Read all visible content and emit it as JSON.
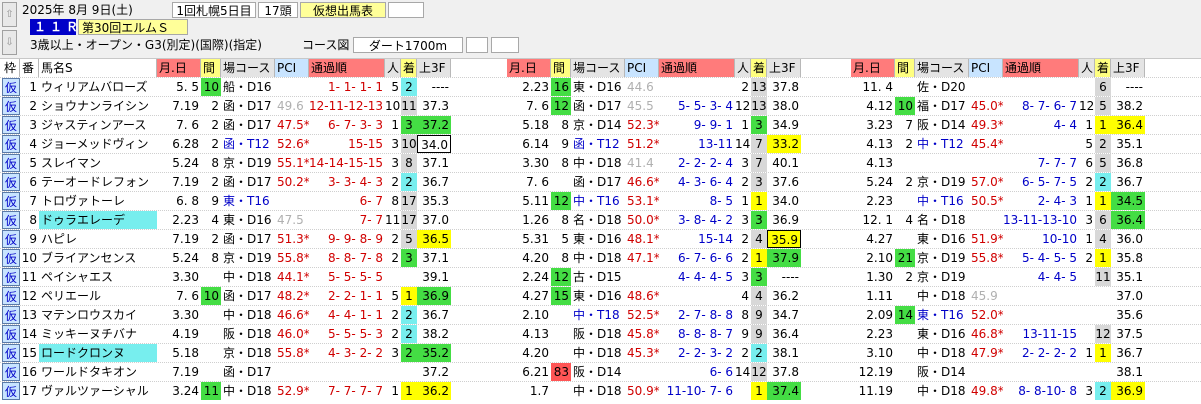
{
  "header": {
    "date": "2025年 8月 9日(土)",
    "kai": "1回札幌5日目",
    "heads": "17頭",
    "status": "仮想出馬表",
    "race_number": "１１Ｒ",
    "race_name": "第30回エルムＳ",
    "conditions": "3歳以上・オープン・G3(別定)(国際)(指定)",
    "course_label": "コース図",
    "course": "ダート1700m"
  },
  "columns": [
    "枠",
    "番",
    "馬名S",
    "月.日",
    "間",
    "場コース",
    "PCI",
    "通過順",
    "人",
    "着",
    "上3F",
    "月.日",
    "間",
    "場コース",
    "PCI",
    "通過順",
    "人",
    "着",
    "上3F",
    "月.日",
    "間",
    "場コース",
    "PCI",
    "通過順",
    "人",
    "着",
    "上3F"
  ],
  "colors": {
    "waku_bg": "#c8e4ff",
    "highlight_yellow": "#ffff00",
    "highlight_green": "#44dd44",
    "highlight_cyan": "#77eeee",
    "highlight_red": "#ff5555",
    "header_red": "#ff7b7b",
    "gray_text": "#b0b0b0"
  },
  "horses": [
    {
      "waku": "仮",
      "num": "1",
      "name": "ウィリアムバローズ",
      "races": [
        {
          "date": "5. 5",
          "int": "10",
          "intc": "g",
          "place": "船・D16",
          "pci": "",
          "pcol": "",
          "pass": "1- 1- 1- 1",
          "pop": "5",
          "fin": "2",
          "finc": "c",
          "f3": "----",
          "f3c": ""
        },
        {
          "date": "2.23",
          "int": "16",
          "intc": "g",
          "place": "東・D16",
          "pci": "44.6",
          "pcol": "gray",
          "pass": "",
          "pop": "2",
          "fin": "13",
          "finc": "gr",
          "f3": "37.8",
          "f3c": ""
        },
        {
          "date": "11. 4",
          "int": "",
          "intc": "",
          "place": "佐・D20",
          "pci": "",
          "pcol": "",
          "pass": "",
          "pop": "",
          "fin": "6",
          "finc": "gr",
          "f3": "----",
          "f3c": ""
        }
      ]
    },
    {
      "waku": "仮",
      "num": "2",
      "name": "ショウナンライシン",
      "races": [
        {
          "date": "7.19",
          "int": "2",
          "intc": "",
          "place": "函・D17",
          "pci": "49.6",
          "pcol": "gray",
          "pass": "12-11-12-13",
          "pop": "10",
          "fin": "11",
          "finc": "gr",
          "f3": "37.3",
          "f3c": ""
        },
        {
          "date": "7. 6",
          "int": "12",
          "intc": "g",
          "place": "函・D17",
          "pci": "45.5",
          "pcol": "gray",
          "pass": "5- 5- 3- 4",
          "pop": "12",
          "fin": "13",
          "finc": "gr",
          "f3": "38.0",
          "f3c": ""
        },
        {
          "date": "4.12",
          "int": "10",
          "intc": "g",
          "place": "福・D17",
          "pci": "45.0*",
          "pcol": "red",
          "pass": "8- 7- 6- 7",
          "pop": "12",
          "fin": "5",
          "finc": "gr",
          "f3": "38.2",
          "f3c": ""
        }
      ]
    },
    {
      "waku": "仮",
      "num": "3",
      "name": "ジャスティンアース",
      "races": [
        {
          "date": "7. 6",
          "int": "2",
          "intc": "",
          "place": "函・D17",
          "pci": "47.5*",
          "pcol": "red",
          "pass": "6- 7- 3- 3",
          "pop": "1",
          "fin": "3",
          "finc": "g",
          "f3": "37.2",
          "f3c": "g"
        },
        {
          "date": "5.18",
          "int": "8",
          "intc": "",
          "place": "京・D14",
          "pci": "52.3*",
          "pcol": "red",
          "pass": "9- 9- 1",
          "pop": "1",
          "fin": "3",
          "finc": "g",
          "f3": "34.9",
          "f3c": ""
        },
        {
          "date": "3.23",
          "int": "7",
          "intc": "",
          "place": "阪・D14",
          "pci": "49.3*",
          "pcol": "red",
          "pass": "4- 4",
          "pop": "1",
          "fin": "1",
          "finc": "y",
          "f3": "36.4",
          "f3c": "y"
        }
      ]
    },
    {
      "waku": "仮",
      "num": "4",
      "name": "ジョーメッドヴィン",
      "races": [
        {
          "date": "6.28",
          "int": "2",
          "intc": "",
          "place": "函・T12",
          "pci": "52.6*",
          "pcol": "red",
          "pass": "15-15",
          "pop": "3",
          "fin": "10",
          "finc": "gr",
          "f3": "34.0",
          "f3c": "box"
        },
        {
          "date": "6.14",
          "int": "9",
          "intc": "",
          "place": "函・T12",
          "pci": "51.2*",
          "pcol": "red",
          "pass": "13-11",
          "pop": "14",
          "fin": "7",
          "finc": "gr",
          "f3": "33.2",
          "f3c": "y"
        },
        {
          "date": "4.13",
          "int": "2",
          "intc": "",
          "place": "中・T12",
          "pci": "45.4*",
          "pcol": "red",
          "pass": "",
          "pop": "5",
          "fin": "2",
          "finc": "gr",
          "f3": "35.1",
          "f3c": ""
        }
      ]
    },
    {
      "waku": "仮",
      "num": "5",
      "name": "スレイマン",
      "races": [
        {
          "date": "5.24",
          "int": "8",
          "intc": "",
          "place": "京・D19",
          "pci": "55.1*",
          "pcol": "red",
          "pass": "14-14-15-15",
          "pop": "3",
          "fin": "8",
          "finc": "gr",
          "f3": "37.1",
          "f3c": ""
        },
        {
          "date": "3.30",
          "int": "8",
          "intc": "",
          "place": "中・D18",
          "pci": "41.4",
          "pcol": "gray",
          "pass": "2- 2- 2- 4",
          "pop": "3",
          "fin": "7",
          "finc": "gr",
          "f3": "40.1",
          "f3c": ""
        },
        {
          "date": "4.13",
          "int": "",
          "intc": "",
          "place": "",
          "pci": "",
          "pcol": "",
          "pass": "7- 7- 7",
          "pop": "6",
          "fin": "5",
          "finc": "gr",
          "f3": "36.8",
          "f3c": ""
        }
      ]
    },
    {
      "waku": "仮",
      "num": "6",
      "name": "テーオードレフォン",
      "races": [
        {
          "date": "7.19",
          "int": "2",
          "intc": "",
          "place": "函・D17",
          "pci": "50.2*",
          "pcol": "red",
          "pass": "3- 3- 4- 3",
          "pop": "2",
          "fin": "2",
          "finc": "c",
          "f3": "36.7",
          "f3c": ""
        },
        {
          "date": "7. 6",
          "int": "",
          "intc": "",
          "place": "函・D17",
          "pci": "46.6*",
          "pcol": "red",
          "pass": "4- 3- 6- 4",
          "pop": "2",
          "fin": "3",
          "finc": "gr",
          "f3": "37.6",
          "f3c": ""
        },
        {
          "date": "5.24",
          "int": "2",
          "intc": "",
          "place": "京・D19",
          "pci": "57.0*",
          "pcol": "red",
          "pass": "6- 5- 7- 5",
          "pop": "2",
          "fin": "2",
          "finc": "c",
          "f3": "36.7",
          "f3c": ""
        }
      ]
    },
    {
      "waku": "仮",
      "num": "7",
      "name": "トロヴァトーレ",
      "races": [
        {
          "date": "6. 8",
          "int": "9",
          "intc": "",
          "place": "東・T16",
          "pci": "",
          "pcol": "",
          "pass": "6- 7",
          "pop": "8",
          "fin": "17",
          "finc": "gr",
          "f3": "35.3",
          "f3c": ""
        },
        {
          "date": "5.11",
          "int": "12",
          "intc": "g",
          "place": "中・T16",
          "pci": "53.1*",
          "pcol": "red",
          "pass": "8- 5",
          "pop": "1",
          "fin": "1",
          "finc": "y",
          "f3": "34.0",
          "f3c": ""
        },
        {
          "date": "2.23",
          "int": "",
          "intc": "",
          "place": "中・T16",
          "pci": "50.5*",
          "pcol": "red",
          "pass": "2- 4- 3",
          "pop": "1",
          "fin": "1",
          "finc": "y",
          "f3": "34.5",
          "f3c": "g"
        }
      ]
    },
    {
      "waku": "仮",
      "num": "8",
      "name": "ドゥラエレーデ",
      "namec": "c",
      "races": [
        {
          "date": "2.23",
          "int": "4",
          "intc": "",
          "place": "東・D16",
          "pci": "47.5",
          "pcol": "gray",
          "pass": "7- 7",
          "pop": "11",
          "fin": "17",
          "finc": "gr",
          "f3": "37.0",
          "f3c": ""
        },
        {
          "date": "1.26",
          "int": "8",
          "intc": "",
          "place": "名・D18",
          "pci": "50.0*",
          "pcol": "red",
          "pass": "3- 8- 4- 2",
          "pop": "3",
          "fin": "3",
          "finc": "g",
          "f3": "36.9",
          "f3c": ""
        },
        {
          "date": "12. 1",
          "int": "4",
          "intc": "",
          "place": "名・D18",
          "pci": "",
          "pcol": "",
          "pass": "13-11-13-10",
          "pop": "3",
          "fin": "6",
          "finc": "gr",
          "f3": "36.4",
          "f3c": "g"
        }
      ]
    },
    {
      "waku": "仮",
      "num": "9",
      "name": "ハピレ",
      "races": [
        {
          "date": "7.19",
          "int": "2",
          "intc": "",
          "place": "函・D17",
          "pci": "51.3*",
          "pcol": "red",
          "pass": "9- 9- 8- 9",
          "pop": "2",
          "fin": "5",
          "finc": "gr",
          "f3": "36.5",
          "f3c": "y"
        },
        {
          "date": "5.31",
          "int": "5",
          "intc": "",
          "place": "東・D16",
          "pci": "48.1*",
          "pcol": "red",
          "pass": "15-14",
          "pop": "2",
          "fin": "4",
          "finc": "gr",
          "f3": "35.9",
          "f3c": "ybox"
        },
        {
          "date": "4.27",
          "int": "",
          "intc": "",
          "place": "東・D16",
          "pci": "51.9*",
          "pcol": "red",
          "pass": "10-10",
          "pop": "1",
          "fin": "4",
          "finc": "gr",
          "f3": "36.0",
          "f3c": ""
        }
      ]
    },
    {
      "waku": "仮",
      "num": "10",
      "name": "ブライアンセンス",
      "races": [
        {
          "date": "5.24",
          "int": "8",
          "intc": "",
          "place": "京・D19",
          "pci": "55.8*",
          "pcol": "red",
          "pass": "8- 8- 7- 8",
          "pop": "2",
          "fin": "3",
          "finc": "g",
          "f3": "37.1",
          "f3c": ""
        },
        {
          "date": "4.20",
          "int": "8",
          "intc": "",
          "place": "中・D18",
          "pci": "47.1*",
          "pcol": "red",
          "pass": "6- 7- 6- 6",
          "pop": "2",
          "fin": "1",
          "finc": "y",
          "f3": "37.9",
          "f3c": "g"
        },
        {
          "date": "2.10",
          "int": "21",
          "intc": "g",
          "place": "京・D19",
          "pci": "55.8*",
          "pcol": "red",
          "pass": "5- 4- 5- 5",
          "pop": "2",
          "fin": "1",
          "finc": "y",
          "f3": "35.8",
          "f3c": ""
        }
      ]
    },
    {
      "waku": "仮",
      "num": "11",
      "name": "ペイシャエス",
      "races": [
        {
          "date": "3.30",
          "int": "",
          "intc": "",
          "place": "中・D18",
          "pci": "44.1*",
          "pcol": "red",
          "pass": "5- 5- 5- 5",
          "pop": "",
          "fin": "",
          "finc": "",
          "f3": "39.1",
          "f3c": ""
        },
        {
          "date": "2.24",
          "int": "12",
          "intc": "g",
          "place": "古・D15",
          "pci": "",
          "pcol": "",
          "pass": "4- 4- 4- 5",
          "pop": "3",
          "fin": "3",
          "finc": "g",
          "f3": "----",
          "f3c": ""
        },
        {
          "date": "1.30",
          "int": "2",
          "intc": "",
          "place": "京・D19",
          "pci": "",
          "pcol": "",
          "pass": "4- 4- 5",
          "pop": "",
          "fin": "11",
          "finc": "gr",
          "f3": "35.1",
          "f3c": ""
        }
      ]
    },
    {
      "waku": "仮",
      "num": "12",
      "name": "ペリエール",
      "races": [
        {
          "date": "7. 6",
          "int": "10",
          "intc": "g",
          "place": "函・D17",
          "pci": "48.2*",
          "pcol": "red",
          "pass": "2- 2- 1- 1",
          "pop": "5",
          "fin": "1",
          "finc": "y",
          "f3": "36.9",
          "f3c": "g"
        },
        {
          "date": "4.27",
          "int": "15",
          "intc": "g",
          "place": "東・D16",
          "pci": "48.6*",
          "pcol": "red",
          "pass": "",
          "pop": "4",
          "fin": "4",
          "finc": "gr",
          "f3": "36.2",
          "f3c": ""
        },
        {
          "date": "1.11",
          "int": "",
          "intc": "",
          "place": "中・D18",
          "pci": "45.9",
          "pcol": "gray",
          "pass": "",
          "pop": "",
          "fin": "",
          "finc": "",
          "f3": "37.0",
          "f3c": ""
        }
      ]
    },
    {
      "waku": "仮",
      "num": "13",
      "name": "マテンロウスカイ",
      "races": [
        {
          "date": "3.30",
          "int": "",
          "intc": "",
          "place": "中・D18",
          "pci": "46.6*",
          "pcol": "red",
          "pass": "4- 4- 1- 1",
          "pop": "2",
          "fin": "2",
          "finc": "c",
          "f3": "36.7",
          "f3c": ""
        },
        {
          "date": "2.10",
          "int": "",
          "intc": "",
          "place": "中・T18",
          "pci": "52.5*",
          "pcol": "red",
          "pass": "2- 7- 8- 8",
          "pop": "8",
          "fin": "9",
          "finc": "gr",
          "f3": "34.7",
          "f3c": ""
        },
        {
          "date": "2.09",
          "int": "14",
          "intc": "g",
          "place": "東・T16",
          "pci": "52.0*",
          "pcol": "red",
          "pass": "",
          "pop": "",
          "fin": "",
          "finc": "",
          "f3": "35.6",
          "f3c": ""
        }
      ]
    },
    {
      "waku": "仮",
      "num": "14",
      "name": "ミッキーヌチバナ",
      "races": [
        {
          "date": "4.19",
          "int": "",
          "intc": "",
          "place": "阪・D18",
          "pci": "46.0*",
          "pcol": "red",
          "pass": "5- 5- 5- 3",
          "pop": "2",
          "fin": "2",
          "finc": "c",
          "f3": "38.2",
          "f3c": ""
        },
        {
          "date": "4.13",
          "int": "",
          "intc": "",
          "place": "阪・D18",
          "pci": "45.8*",
          "pcol": "red",
          "pass": "8- 8- 8- 7",
          "pop": "9",
          "fin": "9",
          "finc": "gr",
          "f3": "36.4",
          "f3c": ""
        },
        {
          "date": "2.23",
          "int": "",
          "intc": "",
          "place": "東・D16",
          "pci": "46.8*",
          "pcol": "red",
          "pass": "13-11-15",
          "pop": "",
          "fin": "12",
          "finc": "gr",
          "f3": "37.5",
          "f3c": ""
        }
      ]
    },
    {
      "waku": "仮",
      "num": "15",
      "name": "ロードクロンヌ",
      "namec": "c",
      "races": [
        {
          "date": "5.18",
          "int": "",
          "intc": "",
          "place": "京・D18",
          "pci": "55.8*",
          "pcol": "red",
          "pass": "4- 3- 2- 2",
          "pop": "3",
          "fin": "2",
          "finc": "g",
          "f3": "35.2",
          "f3c": "g"
        },
        {
          "date": "4.20",
          "int": "",
          "intc": "",
          "place": "中・D18",
          "pci": "45.3*",
          "pcol": "red",
          "pass": "2- 2- 3- 2",
          "pop": "2",
          "fin": "2",
          "finc": "c",
          "f3": "38.1",
          "f3c": ""
        },
        {
          "date": "3.10",
          "int": "",
          "intc": "",
          "place": "中・D18",
          "pci": "47.9*",
          "pcol": "red",
          "pass": "2- 2- 2- 2",
          "pop": "1",
          "fin": "1",
          "finc": "y",
          "f3": "36.7",
          "f3c": ""
        }
      ]
    },
    {
      "waku": "仮",
      "num": "16",
      "name": "ワールドタキオン",
      "races": [
        {
          "date": "7.19",
          "int": "",
          "intc": "",
          "place": "函・D17",
          "pci": "",
          "pcol": "",
          "pass": "",
          "pop": "",
          "fin": "",
          "finc": "",
          "f3": "37.2",
          "f3c": ""
        },
        {
          "date": "6.21",
          "int": "83",
          "intc": "r",
          "place": "阪・D14",
          "pci": "",
          "pcol": "",
          "pass": "6- 6",
          "pop": "14",
          "fin": "12",
          "finc": "gr",
          "f3": "37.8",
          "f3c": ""
        },
        {
          "date": "12.19",
          "int": "",
          "intc": "",
          "place": "阪・D14",
          "pci": "",
          "pcol": "",
          "pass": "",
          "pop": "",
          "fin": "",
          "finc": "",
          "f3": "38.1",
          "f3c": ""
        }
      ]
    },
    {
      "waku": "仮",
      "num": "17",
      "name": "ヴァルツァーシャル",
      "races": [
        {
          "date": "3.24",
          "int": "11",
          "intc": "g",
          "place": "中・D18",
          "pci": "52.9*",
          "pcol": "red",
          "pass": "7- 7- 7- 7",
          "pop": "1",
          "fin": "1",
          "finc": "y",
          "f3": "36.2",
          "f3c": "y"
        },
        {
          "date": "1.7",
          "int": "",
          "intc": "",
          "place": "中・D18",
          "pci": "50.9*",
          "pcol": "red",
          "pass": "11-10- 7- 6",
          "pop": "",
          "fin": "1",
          "finc": "y",
          "f3": "37.4",
          "f3c": "g"
        },
        {
          "date": "11.19",
          "int": "",
          "intc": "",
          "place": "中・D18",
          "pci": "49.8*",
          "pcol": "red",
          "pass": "8- 8-10- 8",
          "pop": "3",
          "fin": "2",
          "finc": "c",
          "f3": "36.9",
          "f3c": "y"
        }
      ]
    }
  ]
}
